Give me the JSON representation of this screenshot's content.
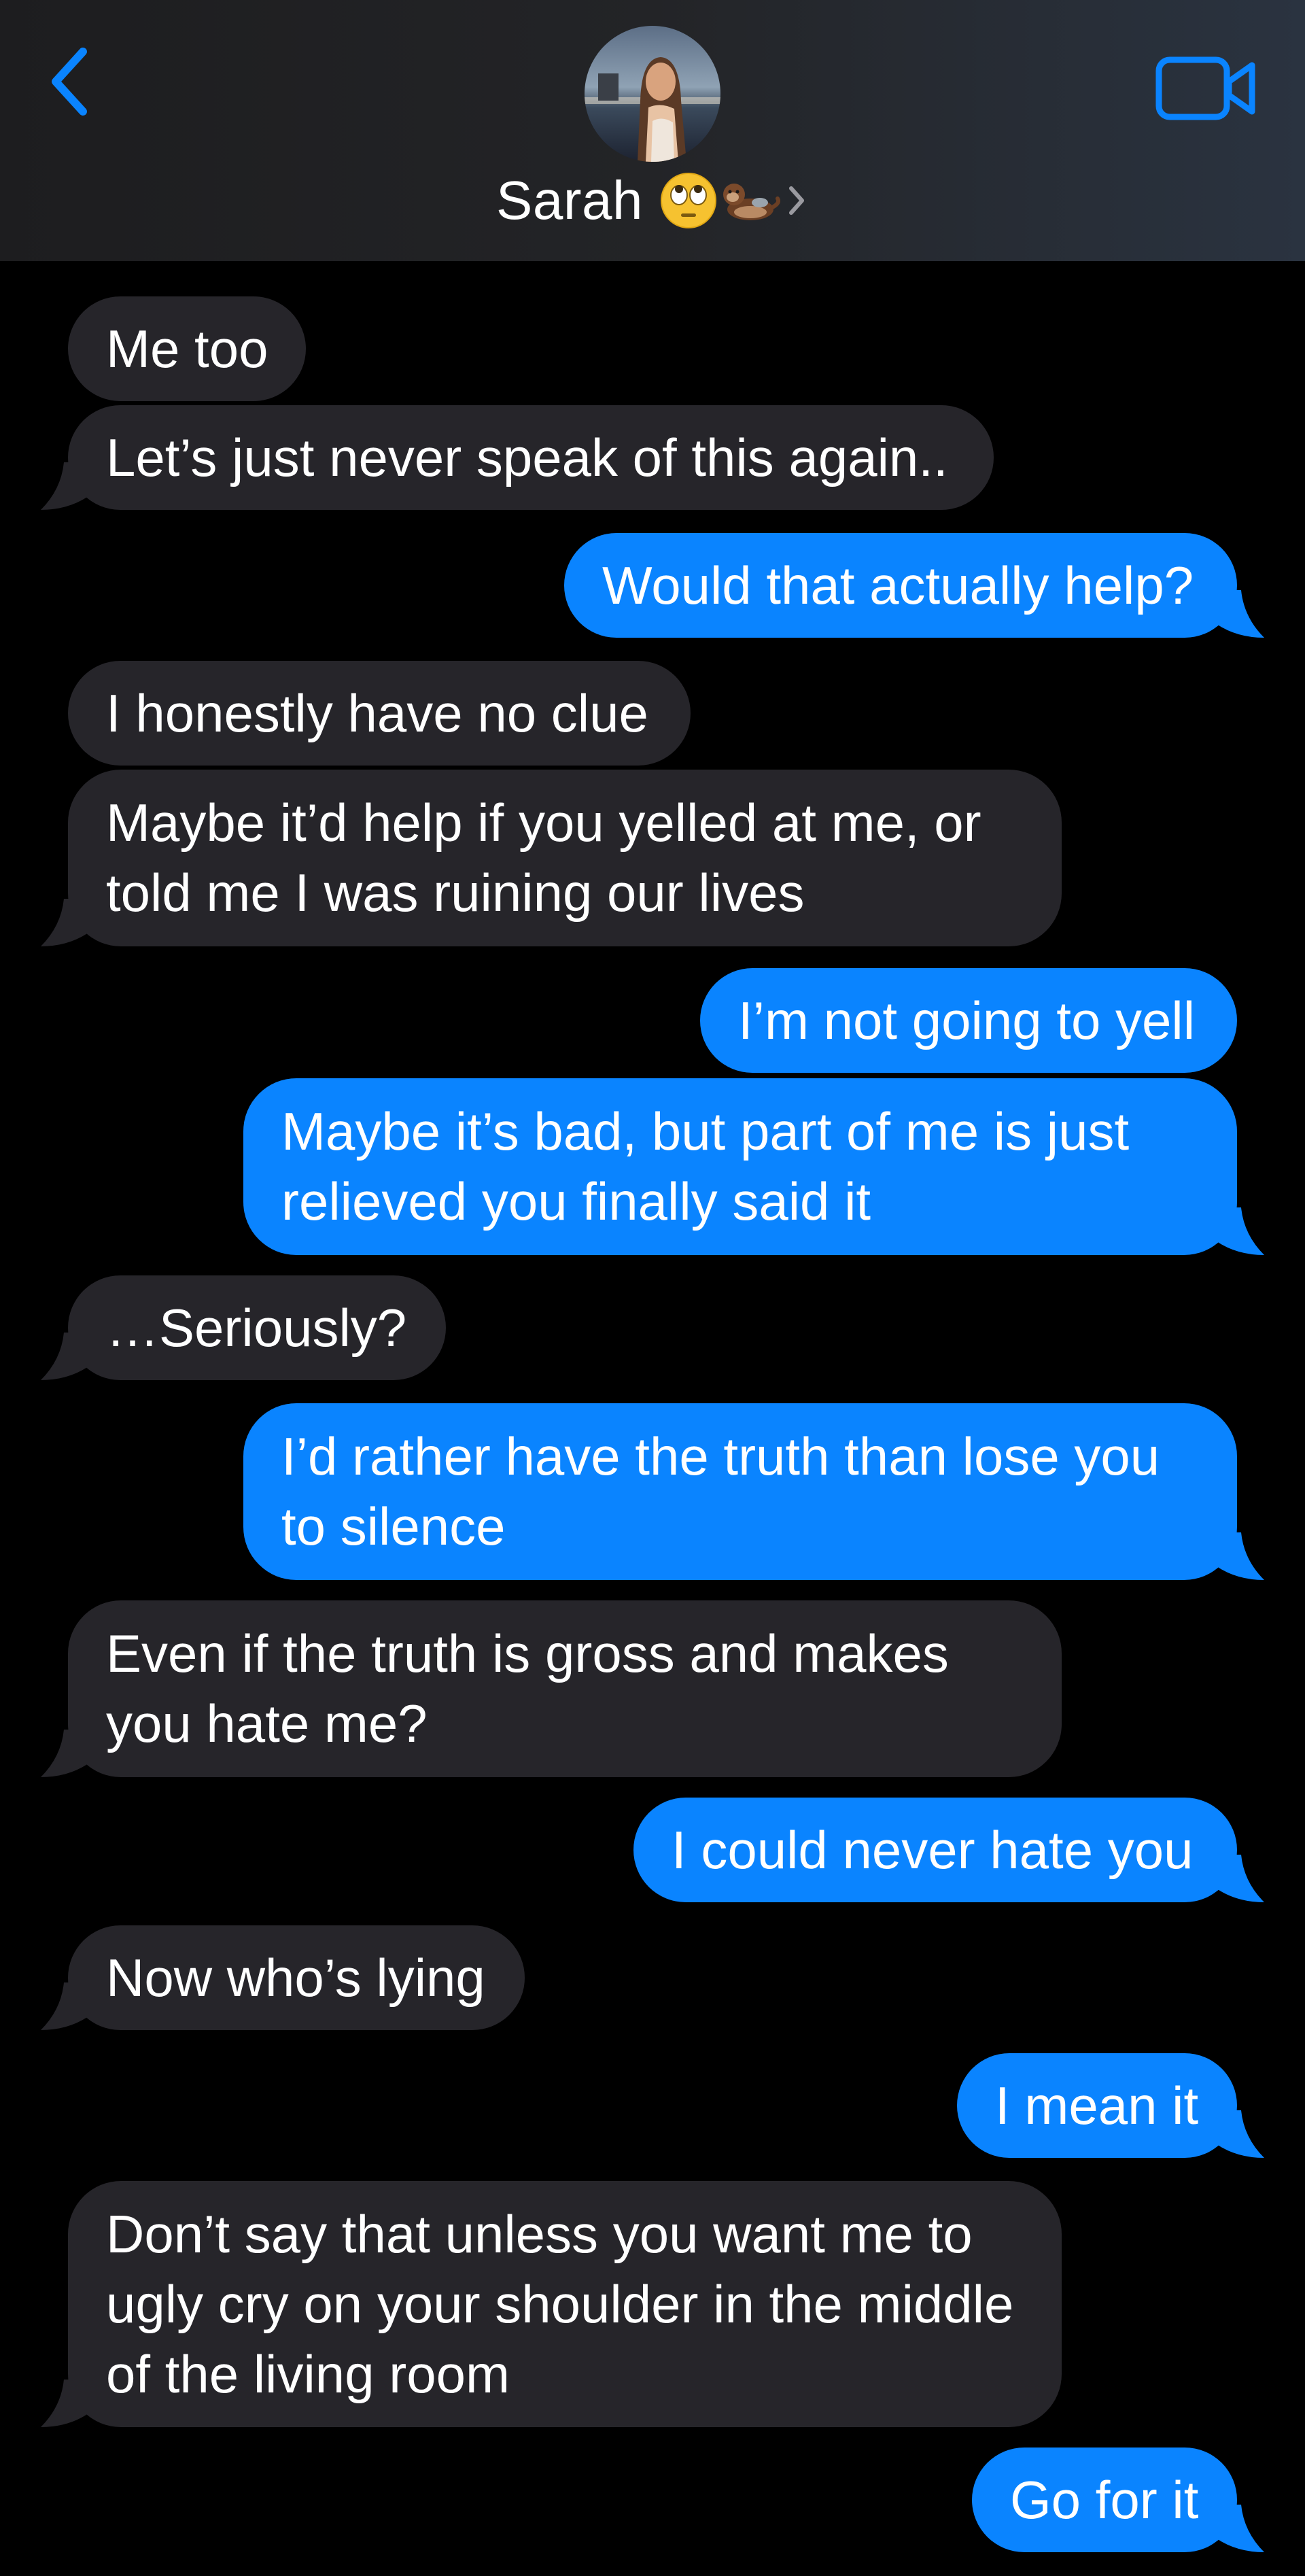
{
  "header": {
    "contact_name": "Sarah",
    "name_emojis": [
      "face-with-rolling-eyes",
      "otter"
    ],
    "back_icon": "chevron-left-icon",
    "video_icon": "video-camera-icon",
    "accent_color": "#0a84ff"
  },
  "messages": [
    {
      "from": "them",
      "text": "Me too"
    },
    {
      "from": "them",
      "text": "Let’s just never speak of this again.."
    },
    {
      "from": "me",
      "text": "Would that actually help?"
    },
    {
      "from": "them",
      "text": "I honestly have no clue"
    },
    {
      "from": "them",
      "text": "Maybe it’d help if you yelled at me, or told me I was ruining our lives"
    },
    {
      "from": "me",
      "text": "I’m not going to yell"
    },
    {
      "from": "me",
      "text": "Maybe it’s bad, but part of me is just relieved you finally said it"
    },
    {
      "from": "them",
      "text": "…Seriously?"
    },
    {
      "from": "me",
      "text": "I’d rather have the truth than lose you to silence"
    },
    {
      "from": "them",
      "text": "Even if the truth is gross and makes you hate me?"
    },
    {
      "from": "me",
      "text": "I could never hate you"
    },
    {
      "from": "them",
      "text": "Now who’s lying"
    },
    {
      "from": "me",
      "text": "I mean it"
    },
    {
      "from": "them",
      "text": "Don’t say that unless you want me to ugly cry on your shoulder in the middle of the living room"
    },
    {
      "from": "me",
      "text": "Go for it"
    }
  ],
  "colors": {
    "sent_bubble": "#0a84ff",
    "received_bubble": "#26252a",
    "background": "#000000"
  }
}
